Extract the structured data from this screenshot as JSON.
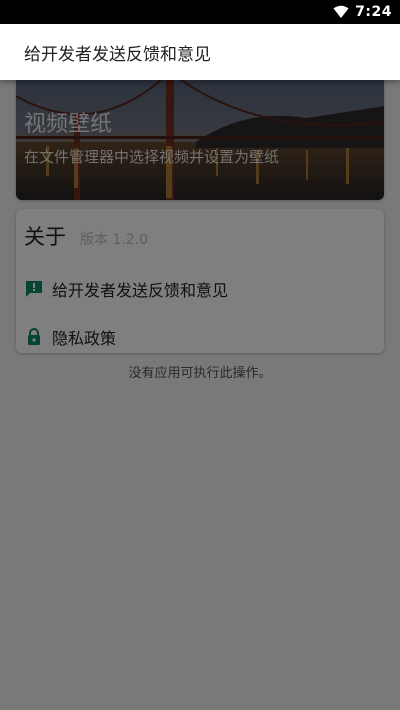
{
  "status_bar": {
    "time": "7:24"
  },
  "dialog": {
    "title": "给开发者发送反馈和意见"
  },
  "wallpaper_card": {
    "title": "视频壁纸",
    "description": "在文件管理器中选择视频并设置为壁纸"
  },
  "about": {
    "title": "关于",
    "version": "版本 1.2.0",
    "items": [
      {
        "label": "给开发者发送反馈和意见",
        "icon": "feedback-icon"
      },
      {
        "label": "隐私政策",
        "icon": "lock-icon"
      }
    ]
  },
  "toast": {
    "message": "没有应用可执行此操作。"
  },
  "colors": {
    "accent": "#0d8a6a",
    "scrim": "rgba(0,0,0,0.5)"
  }
}
